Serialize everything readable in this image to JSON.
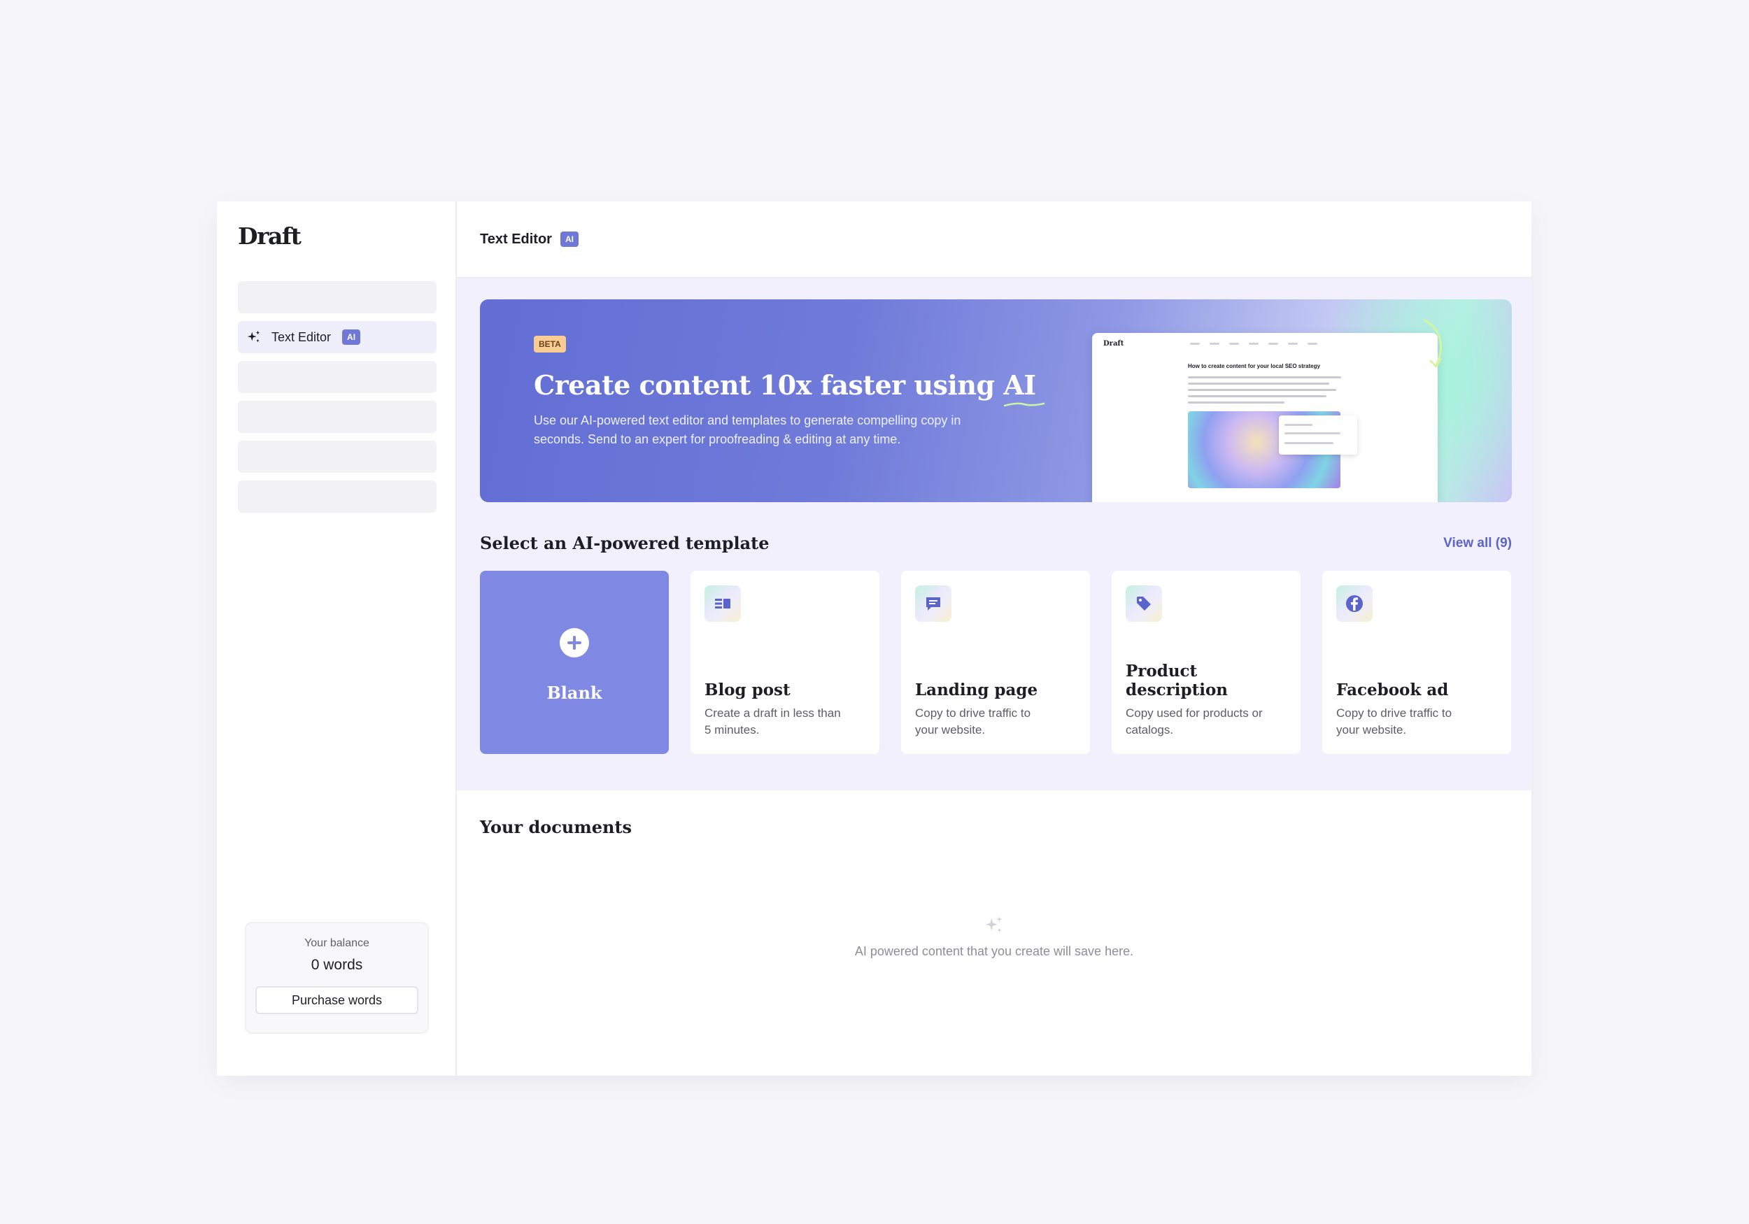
{
  "app": {
    "logo": "Draft"
  },
  "sidebar": {
    "active_item": {
      "label": "Text Editor",
      "badge": "AI",
      "icon": "sparkle-icon"
    },
    "balance": {
      "label": "Your balance",
      "value": "0 words",
      "purchase_label": "Purchase words"
    }
  },
  "header": {
    "title": "Text Editor",
    "badge": "AI"
  },
  "hero": {
    "badge": "BETA",
    "title_prefix": "Create content 10x faster using ",
    "title_highlight": "AI",
    "description": "Use our AI-powered text editor and templates to generate compelling copy in seconds. Send to an expert for proofreading & editing at any time.",
    "preview": {
      "logo": "Draft",
      "heading": "How to create content for your local SEO strategy"
    }
  },
  "templates": {
    "title": "Select an AI-powered template",
    "view_all": "View all (9)",
    "blank_label": "Blank",
    "items": [
      {
        "title": "Blog post",
        "description": "Create a draft in less than 5 minutes.",
        "icon": "blog-icon"
      },
      {
        "title": "Landing page",
        "description": "Copy to drive traffic to your website.",
        "icon": "chat-icon"
      },
      {
        "title": "Product description",
        "description": "Copy used for products or catalogs.",
        "icon": "tag-icon"
      },
      {
        "title": "Facebook ad",
        "description": "Copy to drive traffic to your website.",
        "icon": "facebook-icon"
      }
    ]
  },
  "documents": {
    "title": "Your documents",
    "empty_message": "AI powered content that you create will save here."
  },
  "colors": {
    "accent": "#6f78d6",
    "blank_card": "#7f88e3",
    "link": "#5b64c9",
    "beta_badge": "#f9cc91"
  }
}
